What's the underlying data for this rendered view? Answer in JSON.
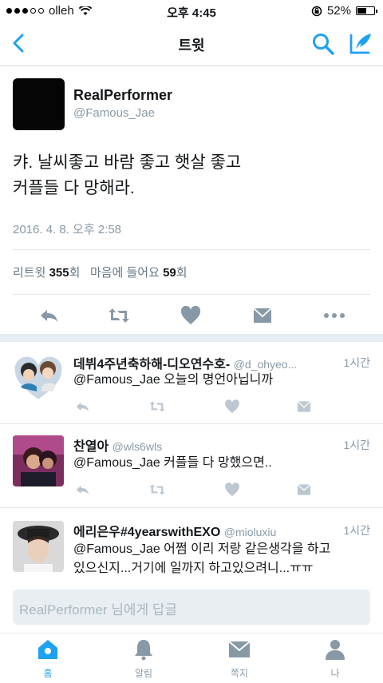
{
  "status": {
    "carrier": "olleh",
    "time": "오후 4:45",
    "battery": "52%"
  },
  "nav": {
    "title": "트윗",
    "back_icon": "chevron-left-icon",
    "search_icon": "search-icon",
    "compose_icon": "compose-icon"
  },
  "tweet": {
    "name": "RealPerformer",
    "handle": "@Famous_Jae",
    "text_line1": "캬. 날씨좋고 바람 좋고 햇살 좋고",
    "text_line2": "커플들 다 망해라.",
    "date": "2016. 4. 8. 오후 2:58",
    "retweet_label": "리트윗",
    "retweet_count": "355",
    "retweet_unit": "회",
    "like_label": "마음에 들어요",
    "like_count": "59",
    "like_unit": "회"
  },
  "replies": [
    {
      "name": "데뷔4주년축하해-디오연수호-",
      "handle": "@d_ohyeo...",
      "time": "1시간",
      "text": "@Famous_Jae 오늘의 명언아닙니까"
    },
    {
      "name": "찬열아",
      "handle": "@wls6wls",
      "time": "1시간",
      "text": "@Famous_Jae  커플들 다 망했으면.."
    },
    {
      "name": "에리은우#4yearswithEXO",
      "handle": "@mioluxiu",
      "time": "1시간",
      "text_line1": "@Famous_Jae 어쩜 이리 저랑 같은생각을 하고",
      "text_line2": "있으신지...거기에 일까지 하고있으려니...ㅠㅠ"
    }
  ],
  "reply_box": {
    "placeholder": "RealPerformer 님에게 답글"
  },
  "tabs": [
    {
      "label": "홈",
      "icon": "home-icon"
    },
    {
      "label": "알림",
      "icon": "bell-icon"
    },
    {
      "label": "쪽지",
      "icon": "envelope-icon"
    },
    {
      "label": "나",
      "icon": "person-icon"
    }
  ],
  "colors": {
    "accent": "#1da1f2",
    "icon_gray": "#8899a6",
    "text": "#14171a"
  }
}
